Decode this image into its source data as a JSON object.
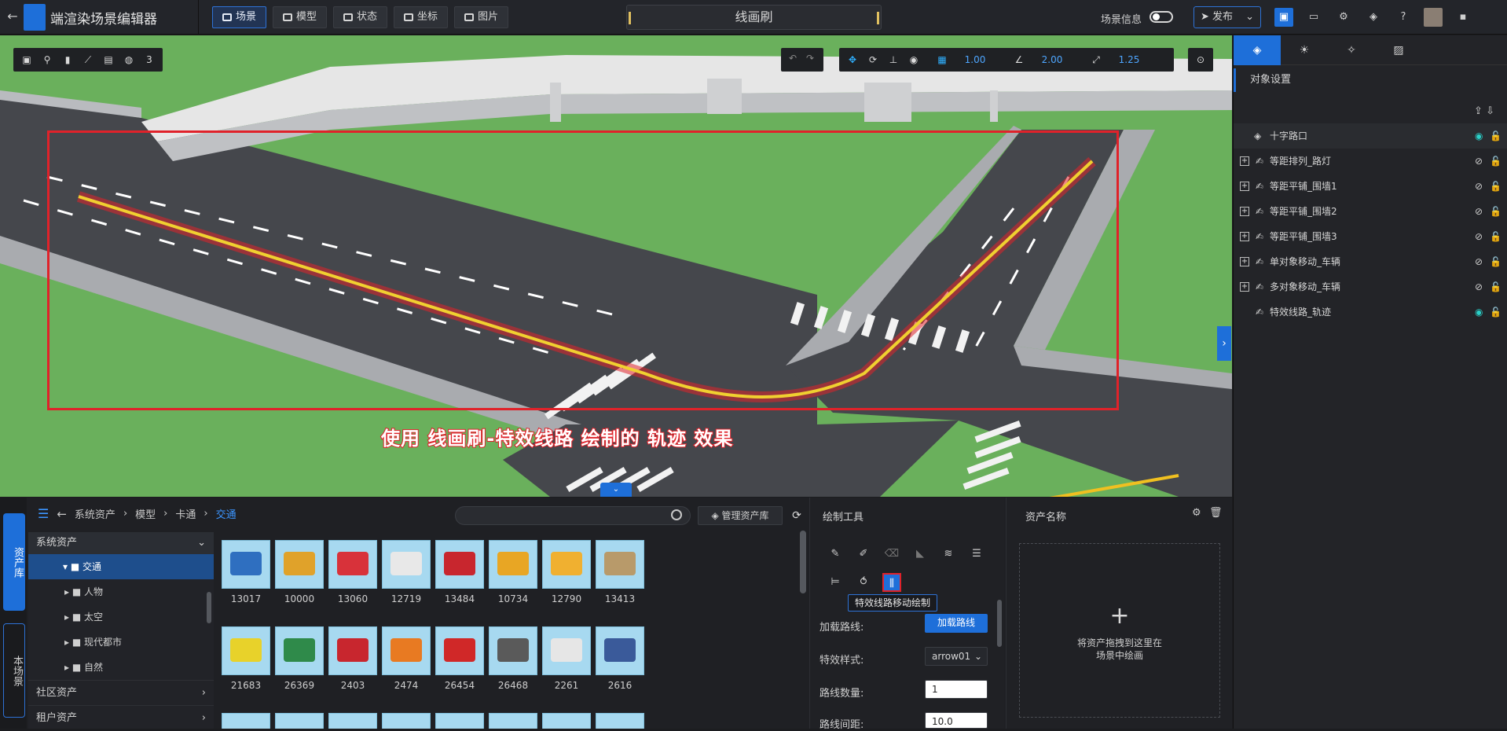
{
  "app": {
    "title": "端渲染场景编辑器",
    "back_icon": "arrow-left-icon",
    "logo_icon": "cube-logo-icon"
  },
  "nav": [
    {
      "label": "场景",
      "active": true,
      "icon": "layers-icon"
    },
    {
      "label": "模型",
      "active": false,
      "icon": "cube-icon"
    },
    {
      "label": "状态",
      "active": false,
      "icon": "grid-icon"
    },
    {
      "label": "坐标",
      "active": false,
      "icon": "pin-icon"
    },
    {
      "label": "图片",
      "active": false,
      "icon": "image-icon"
    }
  ],
  "tool_tab": "线画刷",
  "scene_info_label": "场景信息",
  "publish_label": "发布",
  "viewport": {
    "caption": "使用 线画刷-特效线路 绘制的 轨迹 效果",
    "grid_snap": "1.00",
    "angle_snap": "2.00",
    "scale_snap": "1.25"
  },
  "bottom_tabs": [
    "资产库",
    "本场景"
  ],
  "breadcrumb": [
    "系统资产",
    "模型",
    "卡通",
    "交通"
  ],
  "search_placeholder": "",
  "manage_label": "管理资产库",
  "tree": {
    "header": "系统资产",
    "items": [
      {
        "label": "交通",
        "selected": true
      },
      {
        "label": "人物",
        "selected": false
      },
      {
        "label": "太空",
        "selected": false
      },
      {
        "label": "现代都市",
        "selected": false
      },
      {
        "label": "自然",
        "selected": false
      }
    ],
    "footers": [
      "社区资产",
      "租户资产"
    ]
  },
  "assets": [
    {
      "id": "13017",
      "color": "#2f6fc0"
    },
    {
      "id": "10000",
      "color": "#e0a22a"
    },
    {
      "id": "13060",
      "color": "#d8323a"
    },
    {
      "id": "12719",
      "color": "#e8e8e8"
    },
    {
      "id": "13484",
      "color": "#c8262e"
    },
    {
      "id": "10734",
      "color": "#e8a624"
    },
    {
      "id": "12790",
      "color": "#f0b030"
    },
    {
      "id": "13413",
      "color": "#b89a6a"
    },
    {
      "id": "21683",
      "color": "#e8d22a"
    },
    {
      "id": "26369",
      "color": "#2f8a4a"
    },
    {
      "id": "2403",
      "color": "#c8262e"
    },
    {
      "id": "2474",
      "color": "#e87a22"
    },
    {
      "id": "26454",
      "color": "#d02828"
    },
    {
      "id": "26468",
      "color": "#5a5a5a"
    },
    {
      "id": "2261",
      "color": "#e6e6e6"
    },
    {
      "id": "2616",
      "color": "#3a5a9a"
    }
  ],
  "draw": {
    "title": "绘制工具",
    "tooltip": "特效线路移动绘制",
    "fields": [
      {
        "label": "加载路线:",
        "value": "加载路线",
        "kind": "btn"
      },
      {
        "label": "特效样式:",
        "value": "arrow01",
        "kind": "sel"
      },
      {
        "label": "路线数量:",
        "value": "1",
        "kind": "num"
      },
      {
        "label": "路线间距:",
        "value": "10.0",
        "kind": "num"
      }
    ]
  },
  "asset_panel": {
    "title": "资产名称",
    "drop_line1": "将资产拖拽到这里在",
    "drop_line2": "场景中绘画"
  },
  "right_panel": {
    "heading": "对象设置",
    "objects": [
      {
        "label": "十字路口",
        "top": true,
        "visible": true
      },
      {
        "label": "等距排列_路灯",
        "top": false,
        "visible": false
      },
      {
        "label": "等距平铺_围墙1",
        "top": false,
        "visible": false
      },
      {
        "label": "等距平铺_围墙2",
        "top": false,
        "visible": false
      },
      {
        "label": "等距平铺_围墙3",
        "top": false,
        "visible": false
      },
      {
        "label": "单对象移动_车辆",
        "top": false,
        "visible": false
      },
      {
        "label": "多对象移动_车辆",
        "top": false,
        "visible": false
      },
      {
        "label": "特效线路_轨迹",
        "top": false,
        "visible": true,
        "no_plus": true
      }
    ]
  },
  "colors": {
    "accent": "#1e6fd9",
    "highlight": "#e0222a",
    "grass": "#6ab05c",
    "road": "#45474c"
  }
}
